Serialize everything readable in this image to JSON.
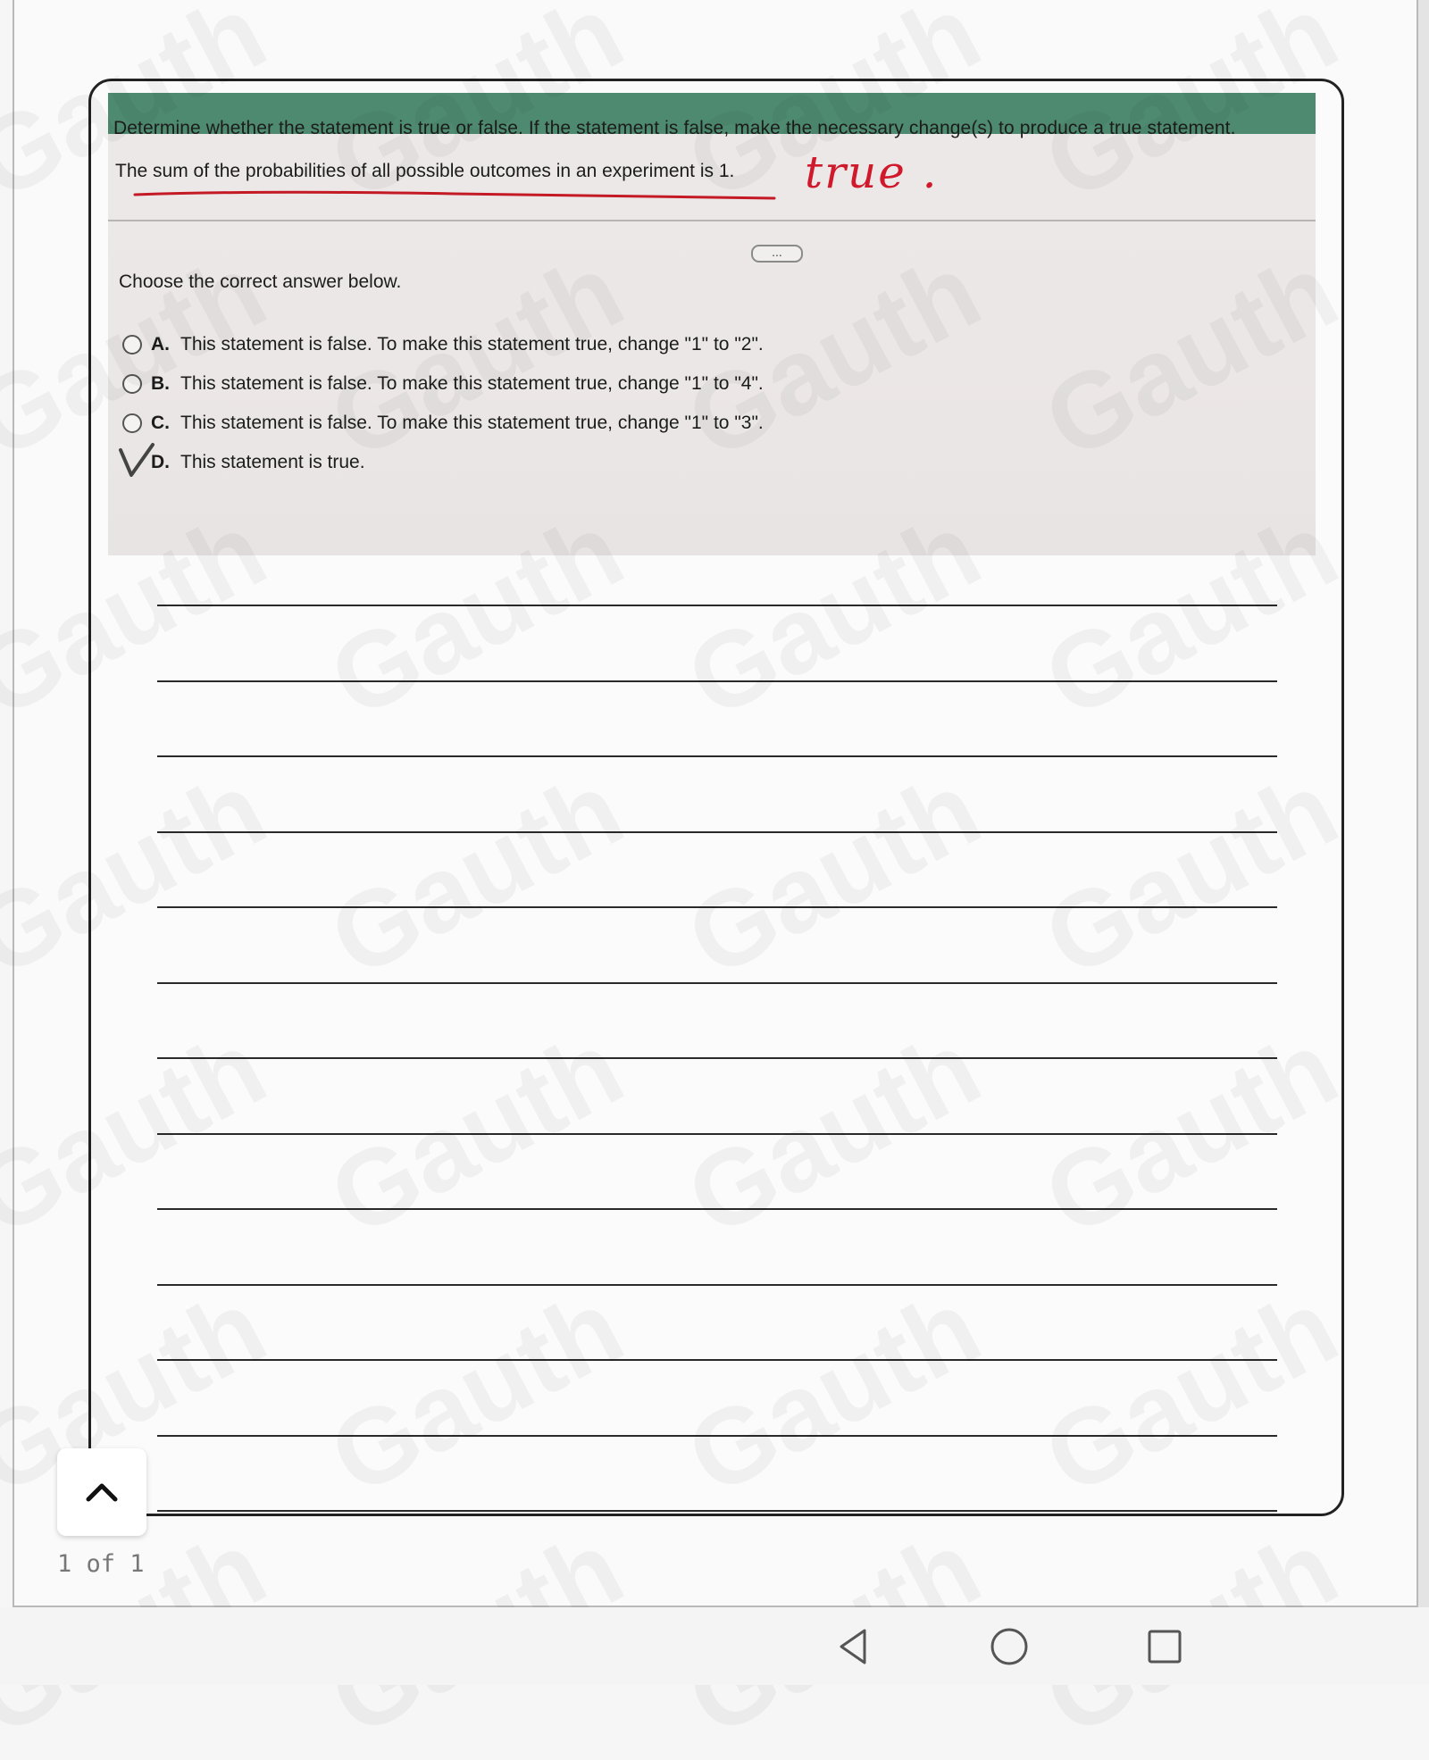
{
  "watermark_text": "Gauth",
  "question": {
    "instruction": "Determine whether the statement is true or false. If the statement is false, make the necessary change(s) to produce a true statement.",
    "statement": "The sum of the probabilities of all possible outcomes in an experiment is 1.",
    "handwritten_answer": "true .",
    "handwriting_color": "#d0192b",
    "more_button_label": "...",
    "choose_label": "Choose the correct answer below.",
    "options": [
      {
        "letter": "A.",
        "text": "This statement is false. To make this statement true, change \"1\" to \"2\"."
      },
      {
        "letter": "B.",
        "text": "This statement is false. To make this statement true, change \"1\" to \"4\"."
      },
      {
        "letter": "C.",
        "text": "This statement is false. To make this statement true, change \"1\" to \"3\"."
      },
      {
        "letter": "D.",
        "text": "This statement is true.",
        "marked": true
      }
    ]
  },
  "ruled_line_count": 13,
  "page_counter": "1 of 1",
  "nav": {
    "back_icon": "triangle-back-icon",
    "home_icon": "circle-home-icon",
    "recents_icon": "square-recents-icon"
  },
  "colors": {
    "header_bar": "#4e8a6f"
  }
}
